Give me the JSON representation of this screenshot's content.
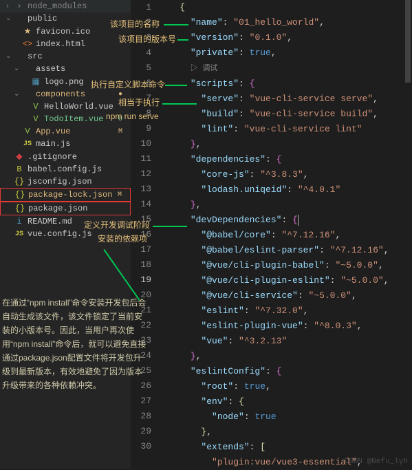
{
  "sidebar": {
    "items": [
      {
        "label": "node_modules",
        "chev": "›",
        "icon": "›",
        "cls": "dim indent-0"
      },
      {
        "label": "public",
        "chev": "⌄",
        "icon": "",
        "cls": "indent-0"
      },
      {
        "label": "favicon.ico",
        "chev": "",
        "icon": "★",
        "iconCls": "ico-star",
        "cls": "indent-1"
      },
      {
        "label": "index.html",
        "chev": "",
        "icon": "<>",
        "iconCls": "ico-html",
        "cls": "indent-1"
      },
      {
        "label": "src",
        "chev": "⌄",
        "icon": "",
        "cls": "indent-0"
      },
      {
        "label": "assets",
        "chev": "⌄",
        "icon": "",
        "cls": "indent-1"
      },
      {
        "label": "logo.png",
        "chev": "",
        "icon": "▦",
        "iconCls": "ico-img",
        "cls": "indent-2"
      },
      {
        "label": "components",
        "chev": "⌄",
        "icon": "",
        "cls": "indent-1 modified",
        "status": "●"
      },
      {
        "label": "HelloWorld.vue",
        "chev": "",
        "icon": "V",
        "iconCls": "ico-vue",
        "cls": "indent-2"
      },
      {
        "label": "TodoItem.vue",
        "chev": "",
        "icon": "V",
        "iconCls": "ico-vue",
        "cls": "indent-2 untracked",
        "status": "U"
      },
      {
        "label": "App.vue",
        "chev": "",
        "icon": "V",
        "iconCls": "ico-vue",
        "cls": "indent-1 modified",
        "status": "M"
      },
      {
        "label": "main.js",
        "chev": "",
        "icon": "JS",
        "iconCls": "ico-js",
        "cls": "indent-1"
      },
      {
        "label": ".gitignore",
        "chev": "",
        "icon": "◆",
        "iconCls": "ico-git",
        "cls": "indent-0"
      },
      {
        "label": "babel.config.js",
        "chev": "",
        "icon": "B",
        "iconCls": "ico-babel",
        "cls": "indent-0"
      },
      {
        "label": "jsconfig.json",
        "chev": "",
        "icon": "{}",
        "iconCls": "ico-json",
        "cls": "indent-0"
      },
      {
        "label": "package-lock.json",
        "chev": "",
        "icon": "{}",
        "iconCls": "ico-json",
        "cls": "indent-0 modified red-box",
        "status": "M"
      },
      {
        "label": "package.json",
        "chev": "",
        "icon": "{}",
        "iconCls": "ico-json",
        "cls": "indent-0 red-box"
      },
      {
        "label": "README.md",
        "chev": "",
        "icon": "i",
        "iconCls": "ico-md",
        "cls": "indent-0"
      },
      {
        "label": "vue.config.js",
        "chev": "",
        "icon": "JS",
        "iconCls": "ico-js",
        "cls": "indent-0"
      }
    ]
  },
  "annotations": {
    "a1": "该项目的名称",
    "a2": "该项目的版本号",
    "a3": "执行自定义脚本命令",
    "a4": "相当于执行",
    "a5": "npm run serve",
    "a6": "定义开发调试阶段",
    "a7": "安装的依赖项",
    "explain": "在通过“npm install”命令安装开发包后会自动生成该文件，该文件锁定了当前安装的小版本号。因此，当用户再次使用“npm install”命令后，就可以避免直接通过package.json配置文件将开发包升级到最新版本，有效地避免了因为版本升级带来的各种依赖冲突。"
  },
  "code": {
    "debug": "▷ 调试",
    "lines": [
      {
        "n": "1",
        "seg": [
          {
            "t": "    ",
            "c": "p"
          },
          {
            "t": "{",
            "c": "y"
          }
        ]
      },
      {
        "n": "2",
        "seg": [
          {
            "t": "      ",
            "c": "p"
          },
          {
            "t": "\"name\"",
            "c": "k"
          },
          {
            "t": ": ",
            "c": "p"
          },
          {
            "t": "\"01_hello_world\"",
            "c": "s"
          },
          {
            "t": ",",
            "c": "p"
          }
        ]
      },
      {
        "n": "3",
        "seg": [
          {
            "t": "      ",
            "c": "p"
          },
          {
            "t": "\"version\"",
            "c": "k"
          },
          {
            "t": ": ",
            "c": "p"
          },
          {
            "t": "\"0.1.0\"",
            "c": "s"
          },
          {
            "t": ",",
            "c": "p"
          }
        ]
      },
      {
        "n": "4",
        "seg": [
          {
            "t": "      ",
            "c": "p"
          },
          {
            "t": "\"private\"",
            "c": "k"
          },
          {
            "t": ": ",
            "c": "p"
          },
          {
            "t": "true",
            "c": "b"
          },
          {
            "t": ",",
            "c": "p"
          }
        ]
      },
      {
        "n": "",
        "seg": [],
        "debug": true
      },
      {
        "n": "5",
        "seg": [
          {
            "t": "      ",
            "c": "p"
          },
          {
            "t": "\"scripts\"",
            "c": "k"
          },
          {
            "t": ": ",
            "c": "p"
          },
          {
            "t": "{",
            "c": "c"
          }
        ]
      },
      {
        "n": "6",
        "seg": [
          {
            "t": "        ",
            "c": "p"
          },
          {
            "t": "\"serve\"",
            "c": "k"
          },
          {
            "t": ": ",
            "c": "p"
          },
          {
            "t": "\"vue-cli-service serve\"",
            "c": "s"
          },
          {
            "t": ",",
            "c": "p"
          }
        ]
      },
      {
        "n": "7",
        "seg": [
          {
            "t": "        ",
            "c": "p"
          },
          {
            "t": "\"build\"",
            "c": "k"
          },
          {
            "t": ": ",
            "c": "p"
          },
          {
            "t": "\"vue-cli-service build\"",
            "c": "s"
          },
          {
            "t": ",",
            "c": "p"
          }
        ]
      },
      {
        "n": "8",
        "seg": [
          {
            "t": "        ",
            "c": "p"
          },
          {
            "t": "\"lint\"",
            "c": "k"
          },
          {
            "t": ": ",
            "c": "p"
          },
          {
            "t": "\"vue-cli-service lint\"",
            "c": "s"
          }
        ]
      },
      {
        "n": "9",
        "seg": [
          {
            "t": "      ",
            "c": "p"
          },
          {
            "t": "}",
            "c": "c"
          },
          {
            "t": ",",
            "c": "p"
          }
        ]
      },
      {
        "n": "10",
        "seg": [
          {
            "t": "      ",
            "c": "p"
          },
          {
            "t": "\"dependencies\"",
            "c": "k"
          },
          {
            "t": ": ",
            "c": "p"
          },
          {
            "t": "{",
            "c": "c"
          }
        ]
      },
      {
        "n": "11",
        "seg": [
          {
            "t": "        ",
            "c": "p"
          },
          {
            "t": "\"core-js\"",
            "c": "k"
          },
          {
            "t": ": ",
            "c": "p"
          },
          {
            "t": "\"^3.8.3\"",
            "c": "s"
          },
          {
            "t": ",",
            "c": "p"
          }
        ]
      },
      {
        "n": "12",
        "seg": [
          {
            "t": "        ",
            "c": "p"
          },
          {
            "t": "\"lodash.uniqeid\"",
            "c": "k"
          },
          {
            "t": ": ",
            "c": "p"
          },
          {
            "t": "\"^4.0.1\"",
            "c": "s"
          }
        ]
      },
      {
        "n": "13",
        "seg": [
          {
            "t": "      ",
            "c": "p"
          },
          {
            "t": "}",
            "c": "c"
          },
          {
            "t": ",",
            "c": "p"
          }
        ]
      },
      {
        "n": "14",
        "seg": [
          {
            "t": "      ",
            "c": "p"
          },
          {
            "t": "\"devDependencies\"",
            "c": "k"
          },
          {
            "t": ": ",
            "c": "p"
          },
          {
            "t": "{",
            "c": "c"
          }
        ],
        "cursor": true
      },
      {
        "n": "15",
        "seg": [
          {
            "t": "        ",
            "c": "p"
          },
          {
            "t": "\"@babel/core\"",
            "c": "k"
          },
          {
            "t": ": ",
            "c": "p"
          },
          {
            "t": "\"^7.12.16\"",
            "c": "s"
          },
          {
            "t": ",",
            "c": "p"
          }
        ]
      },
      {
        "n": "16",
        "seg": [
          {
            "t": "        ",
            "c": "p"
          },
          {
            "t": "\"@babel/eslint-parser\"",
            "c": "k"
          },
          {
            "t": ": ",
            "c": "p"
          },
          {
            "t": "\"^7.12.16\"",
            "c": "s"
          },
          {
            "t": ",",
            "c": "p"
          }
        ]
      },
      {
        "n": "17",
        "seg": [
          {
            "t": "        ",
            "c": "p"
          },
          {
            "t": "\"@vue/cli-plugin-babel\"",
            "c": "k"
          },
          {
            "t": ": ",
            "c": "p"
          },
          {
            "t": "\"~5.0.0\"",
            "c": "s"
          },
          {
            "t": ",",
            "c": "p"
          }
        ]
      },
      {
        "n": "18",
        "seg": [
          {
            "t": "        ",
            "c": "p"
          },
          {
            "t": "\"@vue/cli-plugin-eslint\"",
            "c": "k"
          },
          {
            "t": ": ",
            "c": "p"
          },
          {
            "t": "\"~5.0.0\"",
            "c": "s"
          },
          {
            "t": ",",
            "c": "p"
          }
        ]
      },
      {
        "n": "19",
        "seg": [
          {
            "t": "        ",
            "c": "p"
          },
          {
            "t": "\"@vue/cli-service\"",
            "c": "k"
          },
          {
            "t": ": ",
            "c": "p"
          },
          {
            "t": "\"~5.0.0\"",
            "c": "s"
          },
          {
            "t": ",",
            "c": "p"
          }
        ],
        "hl": true
      },
      {
        "n": "20",
        "seg": [
          {
            "t": "        ",
            "c": "p"
          },
          {
            "t": "\"eslint\"",
            "c": "k"
          },
          {
            "t": ": ",
            "c": "p"
          },
          {
            "t": "\"^7.32.0\"",
            "c": "s"
          },
          {
            "t": ",",
            "c": "p"
          }
        ]
      },
      {
        "n": "21",
        "seg": [
          {
            "t": "        ",
            "c": "p"
          },
          {
            "t": "\"eslint-plugin-vue\"",
            "c": "k"
          },
          {
            "t": ": ",
            "c": "p"
          },
          {
            "t": "\"^8.0.3\"",
            "c": "s"
          },
          {
            "t": ",",
            "c": "p"
          }
        ]
      },
      {
        "n": "22",
        "seg": [
          {
            "t": "        ",
            "c": "p"
          },
          {
            "t": "\"vue\"",
            "c": "k"
          },
          {
            "t": ": ",
            "c": "p"
          },
          {
            "t": "\"^3.2.13\"",
            "c": "s"
          }
        ]
      },
      {
        "n": "23",
        "seg": [
          {
            "t": "      ",
            "c": "p"
          },
          {
            "t": "}",
            "c": "c"
          },
          {
            "t": ",",
            "c": "p"
          }
        ]
      },
      {
        "n": "24",
        "seg": [
          {
            "t": "      ",
            "c": "p"
          },
          {
            "t": "\"eslintConfig\"",
            "c": "k"
          },
          {
            "t": ": ",
            "c": "p"
          },
          {
            "t": "{",
            "c": "c"
          }
        ]
      },
      {
        "n": "25",
        "seg": [
          {
            "t": "        ",
            "c": "p"
          },
          {
            "t": "\"root\"",
            "c": "k"
          },
          {
            "t": ": ",
            "c": "p"
          },
          {
            "t": "true",
            "c": "b"
          },
          {
            "t": ",",
            "c": "p"
          }
        ]
      },
      {
        "n": "26",
        "seg": [
          {
            "t": "        ",
            "c": "p"
          },
          {
            "t": "\"env\"",
            "c": "k"
          },
          {
            "t": ": ",
            "c": "p"
          },
          {
            "t": "{",
            "c": "y"
          }
        ]
      },
      {
        "n": "27",
        "seg": [
          {
            "t": "          ",
            "c": "p"
          },
          {
            "t": "\"node\"",
            "c": "k"
          },
          {
            "t": ": ",
            "c": "p"
          },
          {
            "t": "true",
            "c": "b"
          }
        ]
      },
      {
        "n": "28",
        "seg": [
          {
            "t": "        ",
            "c": "p"
          },
          {
            "t": "}",
            "c": "y"
          },
          {
            "t": ",",
            "c": "p"
          }
        ]
      },
      {
        "n": "29",
        "seg": [
          {
            "t": "        ",
            "c": "p"
          },
          {
            "t": "\"extends\"",
            "c": "k"
          },
          {
            "t": ": ",
            "c": "p"
          },
          {
            "t": "[",
            "c": "y"
          }
        ]
      },
      {
        "n": "30",
        "seg": [
          {
            "t": "          ",
            "c": "p"
          },
          {
            "t": "\"plugin:vue/vue3-essential\"",
            "c": "s"
          },
          {
            "t": ",",
            "c": "p"
          }
        ]
      }
    ]
  },
  "watermark": "CSDN @Nefu_lyh"
}
